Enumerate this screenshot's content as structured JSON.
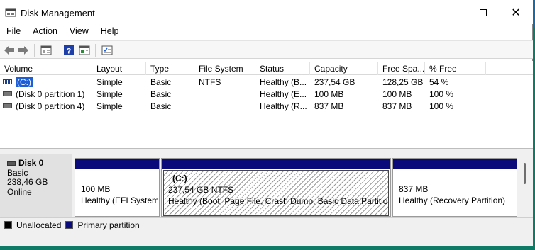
{
  "window": {
    "title": "Disk Management"
  },
  "menu": [
    "File",
    "Action",
    "View",
    "Help"
  ],
  "window_controls": {
    "minimize": "—",
    "maximize": "☐",
    "close": "✕"
  },
  "toolbar": {
    "icons": [
      "back-arrow-icon",
      "forward-arrow-icon",
      "properties-icon",
      "help-icon",
      "console-tree-icon",
      "checklist-icon"
    ]
  },
  "volume_list": {
    "columns": [
      "Volume",
      "Layout",
      "Type",
      "File System",
      "Status",
      "Capacity",
      "Free Spa...",
      "% Free"
    ],
    "rows": [
      {
        "volume": "(C:)",
        "layout": "Simple",
        "type": "Basic",
        "fs": "NTFS",
        "status": "Healthy (B...",
        "capacity": "237,54 GB",
        "free": "128,25 GB",
        "pct": "54 %",
        "selected": true
      },
      {
        "volume": "(Disk 0 partition 1)",
        "layout": "Simple",
        "type": "Basic",
        "fs": "",
        "status": "Healthy (E...",
        "capacity": "100 MB",
        "free": "100 MB",
        "pct": "100 %",
        "selected": false
      },
      {
        "volume": "(Disk 0 partition 4)",
        "layout": "Simple",
        "type": "Basic",
        "fs": "",
        "status": "Healthy (R...",
        "capacity": "837 MB",
        "free": "837 MB",
        "pct": "100 %",
        "selected": false
      }
    ]
  },
  "disk": {
    "name": "Disk 0",
    "type": "Basic",
    "size": "238,46 GB",
    "state": "Online",
    "partitions": [
      {
        "title": "",
        "size_line": "100 MB",
        "status": "Healthy (EFI System"
      },
      {
        "title": "(C:)",
        "size_line": "237,54 GB NTFS",
        "status": "Healthy (Boot, Page File, Crash Dump, Basic Data Partition)"
      },
      {
        "title": "",
        "size_line": "837 MB",
        "status": "Healthy (Recovery Partition)"
      }
    ]
  },
  "legend": [
    {
      "label": "Unallocated",
      "color": "#000000"
    },
    {
      "label": "Primary partition",
      "color": "#0a0a7a"
    }
  ]
}
